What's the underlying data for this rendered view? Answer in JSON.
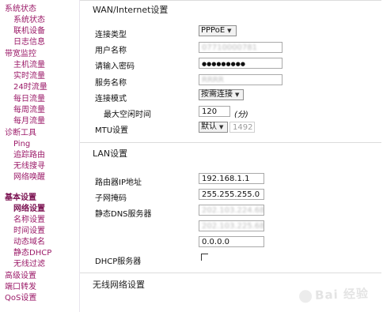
{
  "sidebar": {
    "items": [
      {
        "label": "系统状态",
        "type": "section"
      },
      {
        "label": "系统状态",
        "type": "sub"
      },
      {
        "label": "联机设备",
        "type": "sub"
      },
      {
        "label": "日志信息",
        "type": "sub"
      },
      {
        "label": "带宽监控",
        "type": "section"
      },
      {
        "label": "主机流量",
        "type": "sub"
      },
      {
        "label": "实时流量",
        "type": "sub"
      },
      {
        "label": "24时流量",
        "type": "sub"
      },
      {
        "label": "每日流量",
        "type": "sub"
      },
      {
        "label": "每周流量",
        "type": "sub"
      },
      {
        "label": "每月流量",
        "type": "sub"
      },
      {
        "label": "诊断工具",
        "type": "section"
      },
      {
        "label": "Ping",
        "type": "sub"
      },
      {
        "label": "追踪路由",
        "type": "sub"
      },
      {
        "label": "无线搜寻",
        "type": "sub"
      },
      {
        "label": "网络唤醒",
        "type": "sub"
      },
      {
        "label": "基本设置",
        "type": "section-bold"
      },
      {
        "label": "网络设置",
        "type": "sub-bold"
      },
      {
        "label": "名称设置",
        "type": "sub"
      },
      {
        "label": "时间设置",
        "type": "sub"
      },
      {
        "label": "动态域名",
        "type": "sub"
      },
      {
        "label": "静态DHCP",
        "type": "sub"
      },
      {
        "label": "无线过滤",
        "type": "sub"
      },
      {
        "label": "高级设置",
        "type": "section"
      },
      {
        "label": "端口转发",
        "type": "section"
      },
      {
        "label": "QoS设置",
        "type": "section"
      }
    ]
  },
  "wan": {
    "title": "WAN/Internet设置",
    "connection_type_label": "连接类型",
    "connection_type_value": "PPPoE",
    "username_label": "用户名称",
    "username_value": "07710000781",
    "password_label": "请输入密码",
    "password_value": "●●●●●●●●●",
    "service_label": "服务名称",
    "service_value": "RRRR",
    "connect_mode_label": "连接模式",
    "connect_mode_value": "按需连接",
    "idle_label": "最大空闲时间",
    "idle_value": "120",
    "idle_unit": "(分)",
    "mtu_label": "MTU设置",
    "mtu_mode_value": "默认",
    "mtu_value": "1492"
  },
  "lan": {
    "title": "LAN设置",
    "router_ip_label": "路由器IP地址",
    "router_ip_value": "192.168.1.1",
    "subnet_label": "子网掩码",
    "subnet_value": "255.255.255.0",
    "dns_label": "静态DNS服务器",
    "dns1_value": "202.103.224.68",
    "dns2_value": "202.103.225.68",
    "dns3_value": "0.0.0.0",
    "dhcp_label": "DHCP服务器"
  },
  "wireless": {
    "title": "无线网络设置"
  },
  "watermark": "Bai 经验"
}
